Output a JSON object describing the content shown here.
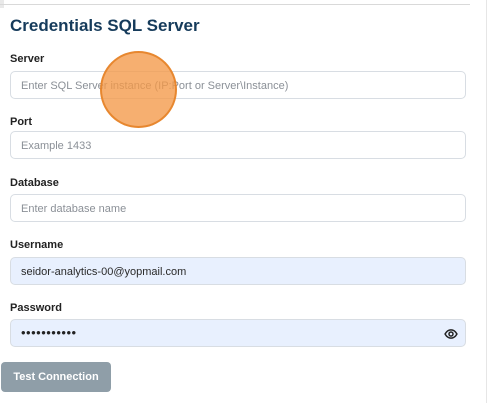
{
  "form": {
    "title": "Credentials SQL Server",
    "server": {
      "label": "Server",
      "value": "",
      "placeholder": "Enter SQL Server instance (IP:Port or Server\\Instance)"
    },
    "port": {
      "label": "Port",
      "value": "",
      "placeholder": "Example 1433"
    },
    "database": {
      "label": "Database",
      "value": "",
      "placeholder": "Enter database name"
    },
    "username": {
      "label": "Username",
      "value": "seidor-analytics-00@yopmail.com",
      "placeholder": ""
    },
    "password": {
      "label": "Password",
      "masked_value": "•••••••••••",
      "icon": "eye-icon"
    },
    "test_connection_label": "Test Connection"
  },
  "colors": {
    "title": "#163b5b",
    "input_border": "#d8dde3",
    "autofill_background": "#e8f0fe",
    "button_background": "#8f9ea8",
    "cursor_highlight": "#f49948"
  }
}
